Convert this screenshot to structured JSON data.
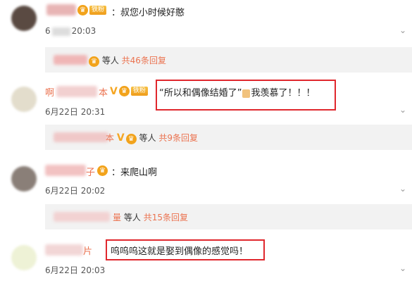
{
  "comments": [
    {
      "text": "：叔您小时候好憨",
      "time": "20:03",
      "date_prefix": "6",
      "fan_badge": "铁粉",
      "reply": {
        "label": "等人",
        "count": "共46条回复"
      }
    },
    {
      "name_prefix": "啊",
      "name_suffix": "本",
      "text_quote": "“所以和偶像结婚了”",
      "text_tail": "我羡慕了！！！",
      "time": "6月22日 20:31",
      "fan_badge": "铁粉",
      "reply": {
        "name_suffix": "本",
        "label": "等人",
        "count": "共9条回复"
      }
    },
    {
      "name_suffix": "子",
      "text": "：来爬山啊",
      "time": "6月22日 20:02",
      "reply": {
        "name_suffix": "量",
        "label": "等人",
        "count": "共15条回复"
      }
    },
    {
      "name_suffix": "片",
      "text": "呜呜呜这就是娶到偶像的感觉吗！",
      "time": "6月22日 20:03"
    }
  ],
  "icons": {
    "vip": "vip-crown-icon",
    "chevron": "chevron-down-icon",
    "thumb": "thumbs-up-emoji-icon"
  },
  "colors": {
    "highlight": "#e0272d",
    "reply_count": "#eb7350",
    "reply_bg": "#f2f2f2"
  }
}
